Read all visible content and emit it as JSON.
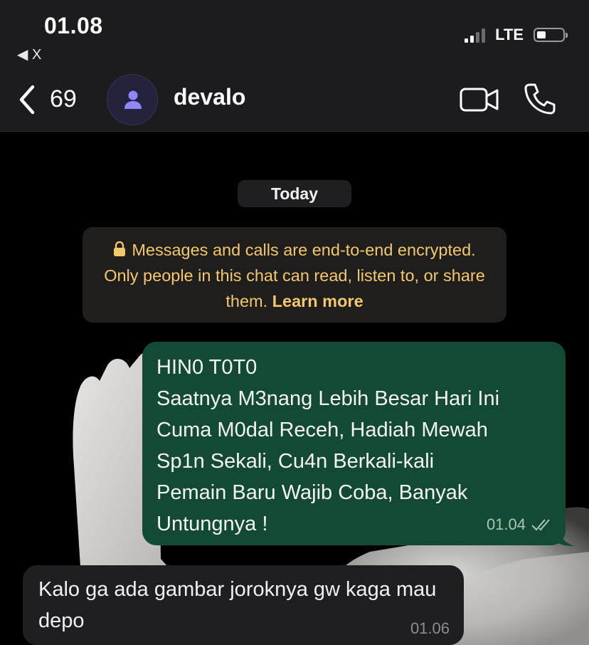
{
  "status": {
    "time": "01.08",
    "back_app": "◀ X",
    "network": "LTE"
  },
  "header": {
    "unread_count": "69",
    "contact_name": "devalo"
  },
  "chat": {
    "day_label": "Today",
    "encryption_notice": {
      "text": "Messages and calls are end-to-end encrypted. Only people in this chat can read, listen to, or share them.",
      "link": "Learn more",
      "color": "#f2c86b"
    },
    "messages": [
      {
        "direction": "outgoing",
        "text": "HIN0 T0T0\nSaatnya M3nang Lebih Besar Hari Ini\nCuma M0dal Receh, Hadiah Mewah\nSp1n Sekali, Cu4n Berkali-kali\nPemain Baru Wajib Coba, Banyak\nUntungnya !",
        "time": "01.04",
        "status_icon": "double-check-icon",
        "color": "#124a33"
      },
      {
        "direction": "incoming",
        "text": "Kalo ga ada gambar joroknya gw kaga mau depo",
        "time": "01.06",
        "color": "#1f1f21"
      }
    ]
  },
  "colors": {
    "header_bg": "#1c1c1e",
    "chat_bg": "#000000",
    "outgoing_bubble": "#124a33",
    "incoming_bubble": "#1f1f21"
  }
}
